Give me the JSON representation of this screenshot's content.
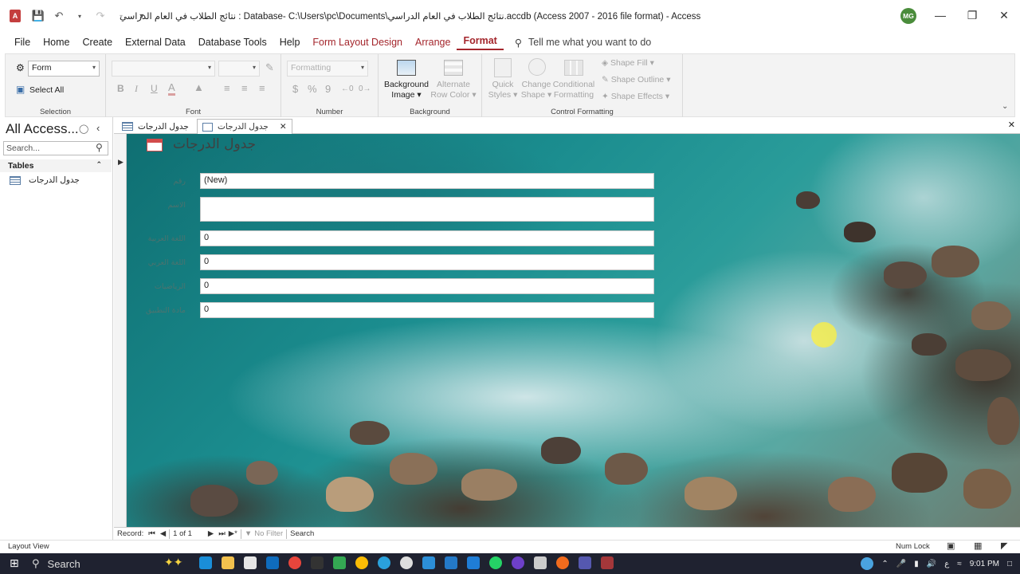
{
  "window": {
    "title": "نتائج الطلاب في العام الدراسي : Database- C:\\Users\\pc\\Documents\\نتائج الطلاب في العام الدراسي.accdb (Access 2007 - 2016 file format)  -  Access",
    "user_initials": "MG",
    "app_icon_label": "A"
  },
  "ribbon_tabs": [
    "File",
    "Home",
    "Create",
    "External Data",
    "Database Tools",
    "Help",
    "Form Layout Design",
    "Arrange",
    "Format"
  ],
  "active_tab": "Format",
  "tell_me": "Tell me what you want to do",
  "ribbon": {
    "selection": {
      "object_value": "Form",
      "select_all": "Select All",
      "label": "Selection"
    },
    "font": {
      "label": "Font",
      "bold": "B",
      "italic": "I",
      "underline": "U",
      "font_color": "A"
    },
    "number": {
      "format_value": "Formatting",
      "currency": "$",
      "percent": "%",
      "comma": "9",
      "label": "Number"
    },
    "background": {
      "background_image": "Background Image",
      "alternate_row_color": "Alternate Row Color",
      "label": "Background"
    },
    "control_formatting": {
      "quick_styles": "Quick Styles",
      "change_shape": "Change Shape",
      "conditional_formatting": "Conditional Formatting",
      "shape_fill": "Shape Fill",
      "shape_outline": "Shape Outline",
      "shape_effects": "Shape Effects",
      "label": "Control Formatting"
    }
  },
  "nav_pane": {
    "title": "All Access...",
    "search_placeholder": "Search...",
    "section": "Tables",
    "items": [
      {
        "label": "جدول الدرجات",
        "icon": "table-icon"
      }
    ]
  },
  "doc_tabs": [
    {
      "label": "جدول الدرجات",
      "icon": "table-icon",
      "active": false
    },
    {
      "label": "جدول الدرجات",
      "icon": "form-icon",
      "active": true
    }
  ],
  "form": {
    "title": "جدول الدرجات",
    "fields": [
      {
        "label": "رقم",
        "value": "(New)"
      },
      {
        "label": "الاسم",
        "value": ""
      },
      {
        "label": "اللغة العربية",
        "value": "0"
      },
      {
        "label": "اللغة العربي",
        "value": "0"
      },
      {
        "label": "الرياضيات",
        "value": "0"
      },
      {
        "label": "مادة التطبيق",
        "value": "0"
      }
    ]
  },
  "record_nav": {
    "record_label": "Record:",
    "position": "1 of 1",
    "filter": "No Filter",
    "search": "Search"
  },
  "status_bar": {
    "view": "Layout View",
    "num_lock": "Num Lock"
  },
  "taskbar": {
    "search": "Search",
    "time": "9:01 PM",
    "lang": "ع"
  }
}
